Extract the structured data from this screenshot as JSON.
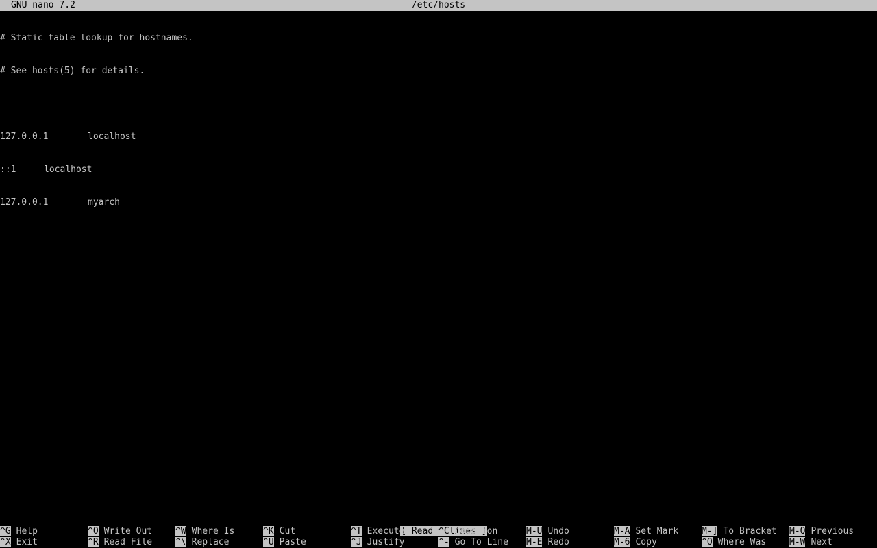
{
  "titlebar": {
    "app_version": "GNU nano 7.2",
    "file_name": "/etc/hosts"
  },
  "lines": [
    {
      "text": "# Static table lookup for hostnames."
    },
    {
      "text": "# See hosts(5) for details."
    },
    {
      "text": ""
    },
    {
      "address": "127.0.0.1",
      "host": "localhost"
    },
    {
      "address": "::1",
      "host": "localhost"
    },
    {
      "address": "127.0.0.1",
      "host": "myarch"
    }
  ],
  "status": "[ Read 6 lines ]",
  "shortcuts_row1": [
    {
      "key": "^G",
      "label": "Help"
    },
    {
      "key": "^O",
      "label": "Write Out"
    },
    {
      "key": "^W",
      "label": "Where Is"
    },
    {
      "key": "^K",
      "label": "Cut"
    },
    {
      "key": "^T",
      "label": "Execute"
    },
    {
      "key": "^C",
      "label": "Location"
    },
    {
      "key": "M-U",
      "label": "Undo"
    },
    {
      "key": "M-A",
      "label": "Set Mark"
    },
    {
      "key": "M-]",
      "label": "To Bracket"
    },
    {
      "key": "M-Q",
      "label": "Previous"
    }
  ],
  "shortcuts_row2": [
    {
      "key": "^X",
      "label": "Exit"
    },
    {
      "key": "^R",
      "label": "Read File"
    },
    {
      "key": "^\\",
      "label": "Replace"
    },
    {
      "key": "^U",
      "label": "Paste"
    },
    {
      "key": "^J",
      "label": "Justify"
    },
    {
      "key": "^-",
      "label": "Go To Line"
    },
    {
      "key": "M-E",
      "label": "Redo"
    },
    {
      "key": "M-6",
      "label": "Copy"
    },
    {
      "key": "^Q",
      "label": "Where Was"
    },
    {
      "key": "M-W",
      "label": "Next"
    }
  ],
  "colors": {
    "background": "#000000",
    "foreground": "#c4c4c4"
  }
}
